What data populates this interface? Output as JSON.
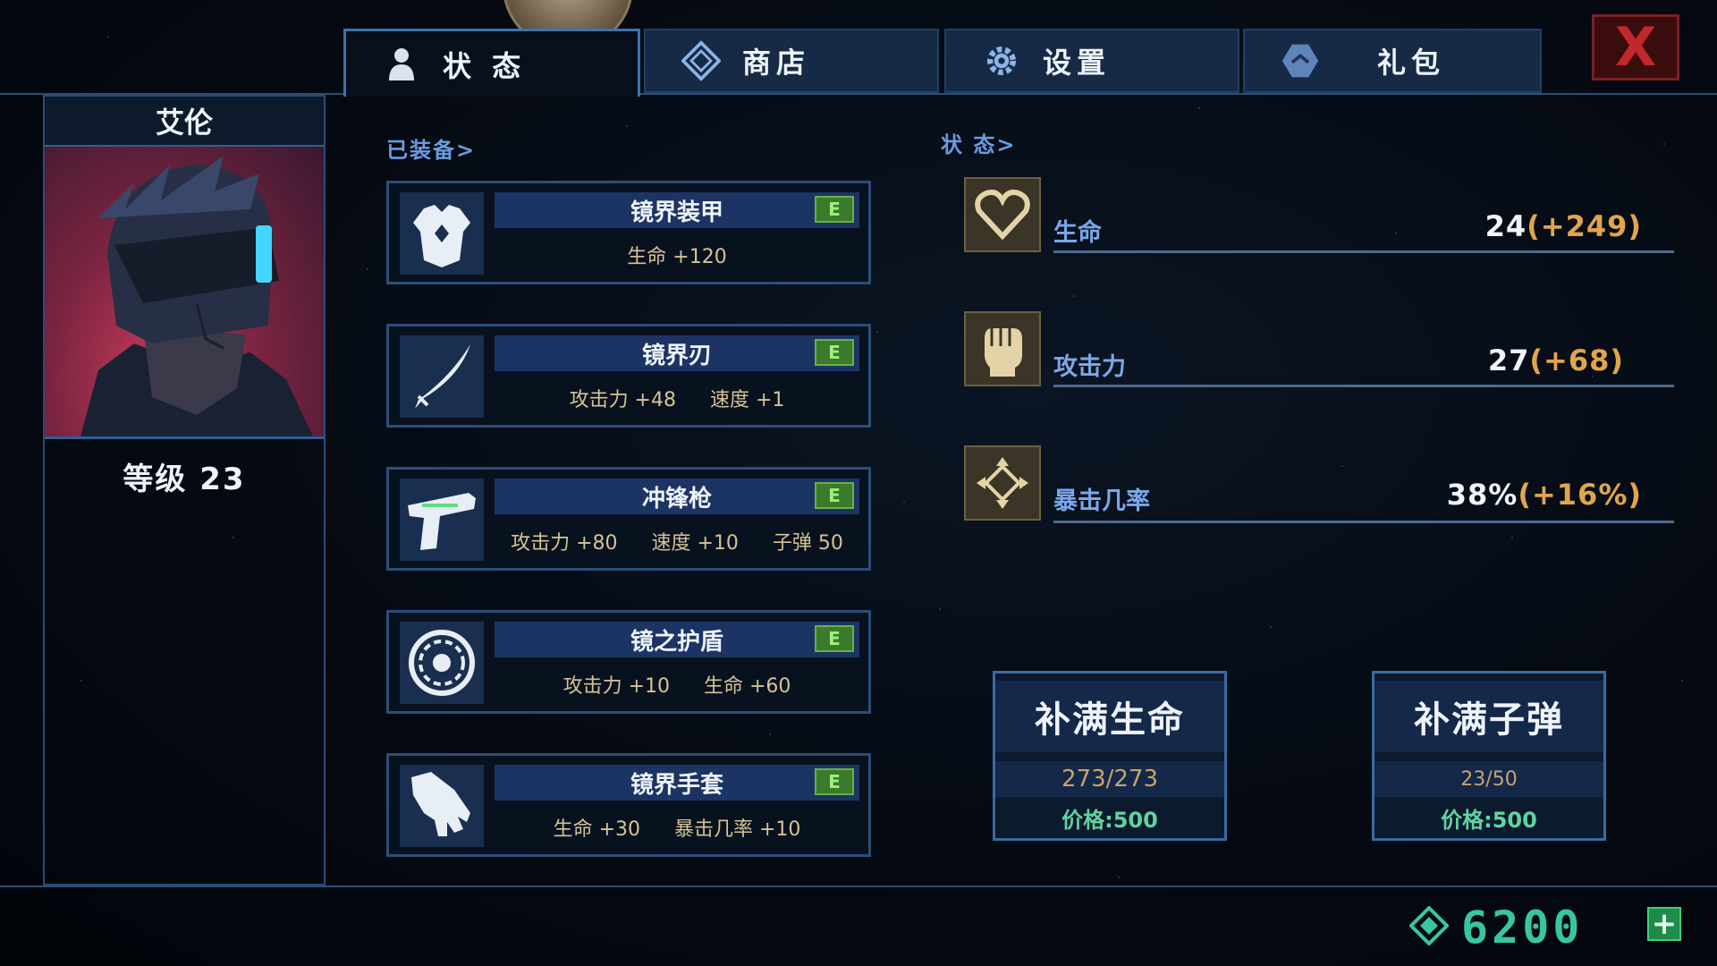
{
  "tabs": [
    {
      "label": "状 态",
      "icon": "person-icon",
      "active": true
    },
    {
      "label": "商店",
      "icon": "diamond-icon",
      "active": false
    },
    {
      "label": "设置",
      "icon": "gear-icon",
      "active": false
    },
    {
      "label": "礼包",
      "icon": "gift-icon",
      "active": false
    }
  ],
  "close_label": "X",
  "character": {
    "name": "艾伦",
    "level": "等级 23"
  },
  "equipped_label": "已装备>",
  "status_label": "状 态>",
  "equipment": [
    {
      "name": "镜界装甲",
      "badge": "E",
      "icon": "armor-icon",
      "stats": [
        "生命 +120"
      ]
    },
    {
      "name": "镜界刃",
      "badge": "E",
      "icon": "blade-icon",
      "stats": [
        "攻击力 +48",
        "速度 +1"
      ]
    },
    {
      "name": "冲锋枪",
      "badge": "E",
      "icon": "gun-icon",
      "stats": [
        "攻击力 +80",
        "速度 +10",
        "子弹 50"
      ]
    },
    {
      "name": "镜之护盾",
      "badge": "E",
      "icon": "shield-icon",
      "stats": [
        "攻击力 +10",
        "生命 +60"
      ]
    },
    {
      "name": "镜界手套",
      "badge": "E",
      "icon": "glove-icon",
      "stats": [
        "生命 +30",
        "暴击几率 +10"
      ]
    }
  ],
  "stats": [
    {
      "label": "生命",
      "base": "24",
      "bonus": "(+249)",
      "icon": "heart-icon"
    },
    {
      "label": "攻击力",
      "base": "27",
      "bonus": "(+68)",
      "icon": "fist-icon"
    },
    {
      "label": "暴击几率",
      "base": "38%",
      "bonus": "(+16%)",
      "icon": "crosshair-icon"
    }
  ],
  "refill_health": {
    "title": "补满生命",
    "count": "273/273",
    "price": "价格:500"
  },
  "refill_ammo": {
    "title": "补满子弹",
    "count": "23/50",
    "price": "价格:500"
  },
  "currency": {
    "amount": "6200",
    "icon": "gem-icon",
    "accent": "#38c69e"
  }
}
